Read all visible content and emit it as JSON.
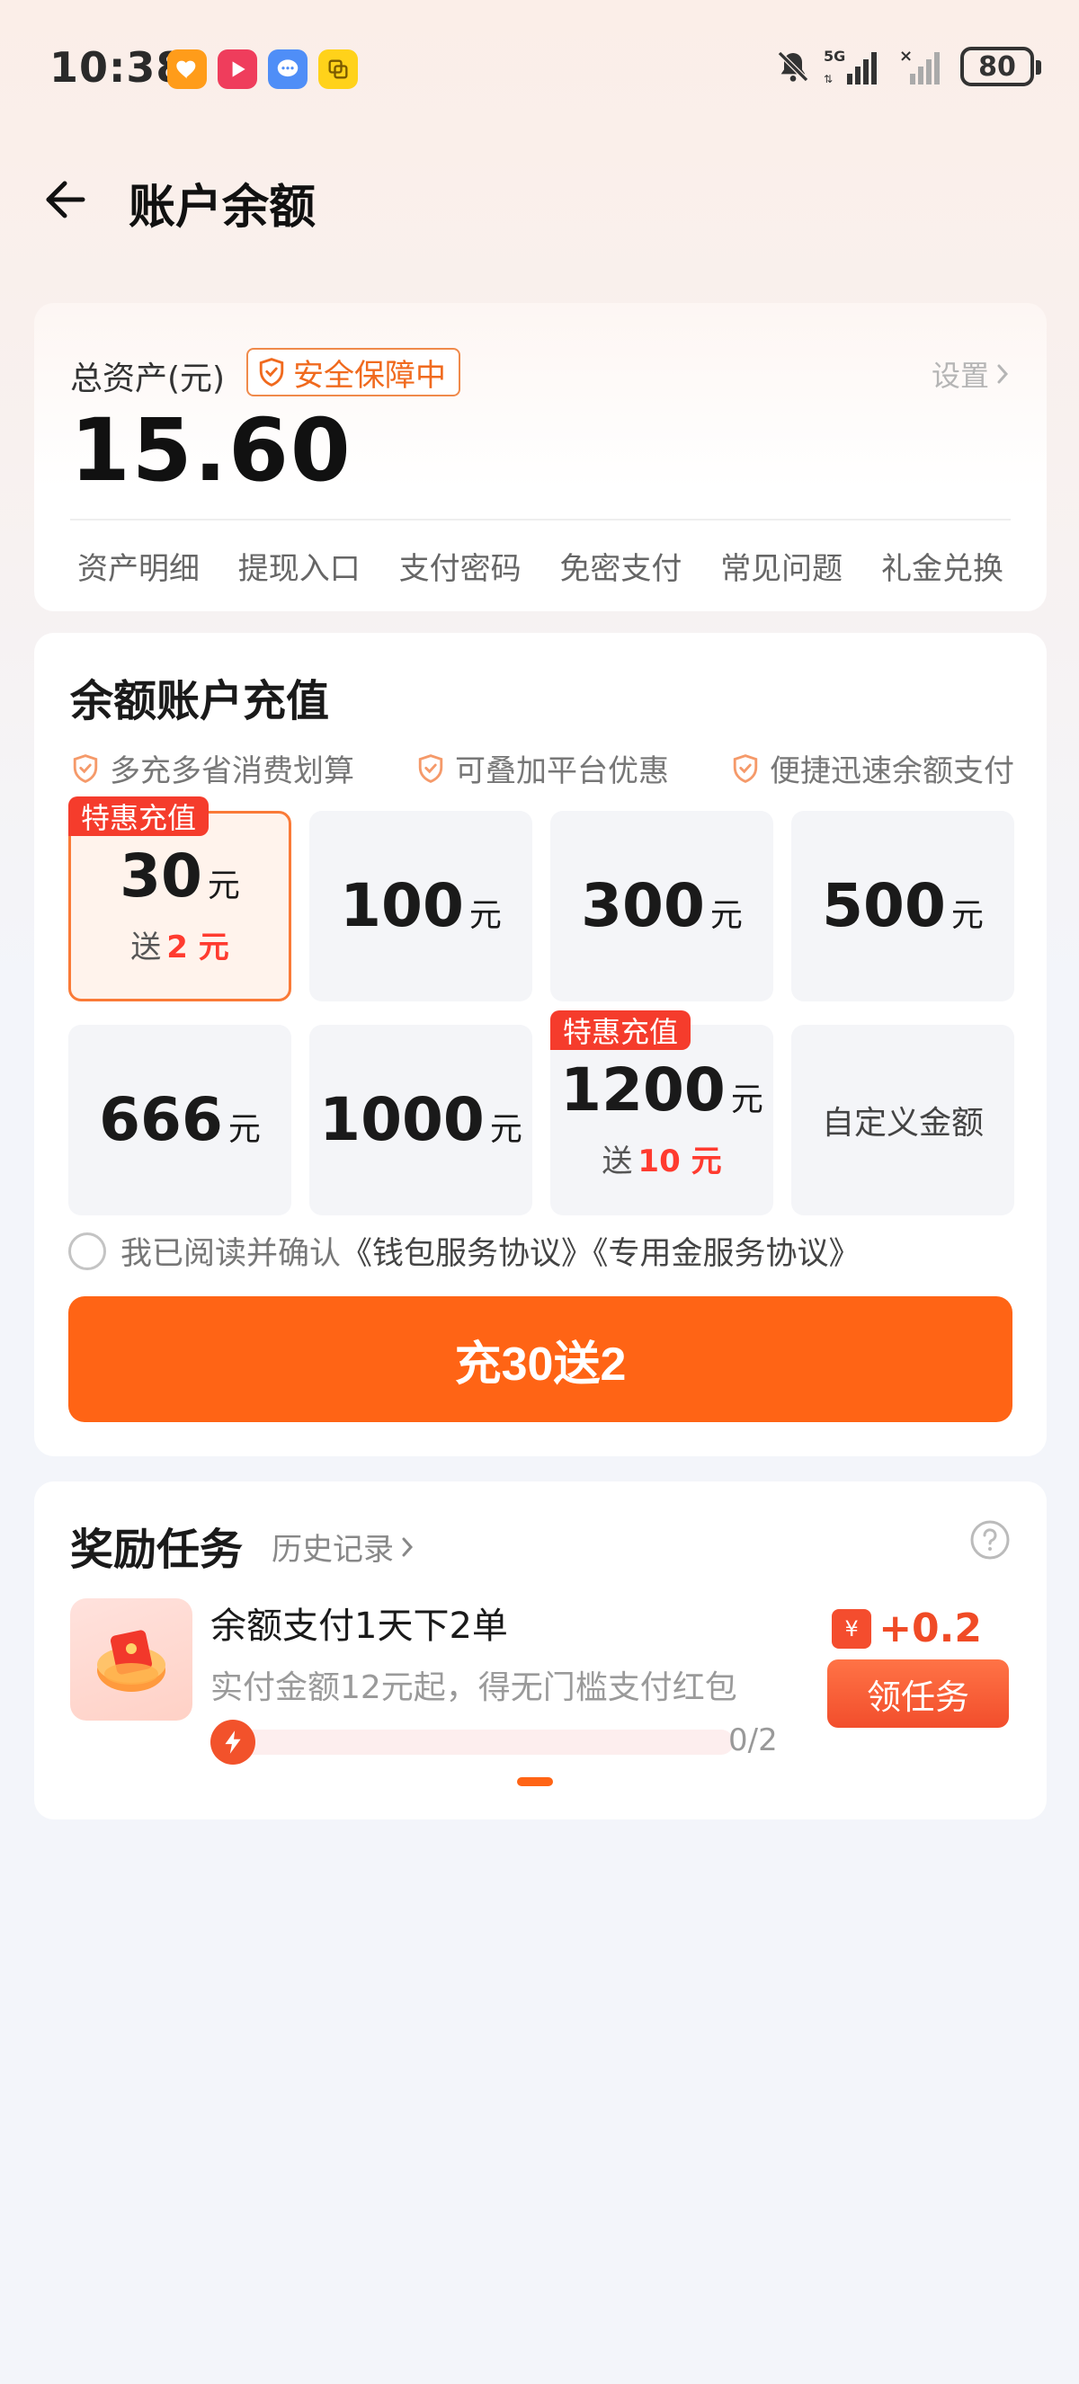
{
  "status_bar": {
    "time": "10:38",
    "battery": "80",
    "network": "5G",
    "app_icons": [
      "heart-app-icon",
      "video-app-icon",
      "message-app-icon",
      "copy-app-icon"
    ],
    "sys_icons": [
      "mute-icon",
      "signal-icon",
      "no-signal-icon",
      "battery-icon"
    ]
  },
  "header": {
    "title": "账户余额",
    "back_icon": "arrow-left-icon"
  },
  "balance": {
    "label": "总资产(元)",
    "safe_badge": "安全保障中",
    "settings": "设置",
    "amount": "15.60",
    "links": [
      "资产明细",
      "提现入口",
      "支付密码",
      "免密支付",
      "常见问题",
      "礼金兑换"
    ]
  },
  "recharge": {
    "title": "余额账户充值",
    "features": [
      "多充多省消费划算",
      "可叠加平台优惠",
      "便捷迅速余额支付"
    ],
    "unit": "元",
    "bonus_prefix": "送",
    "promo_tag": "特惠充值",
    "tiers": [
      {
        "value": "30",
        "bonus": "2 元",
        "selected": true,
        "promo": true
      },
      {
        "value": "100",
        "bonus": null,
        "selected": false,
        "promo": false
      },
      {
        "value": "300",
        "bonus": null,
        "selected": false,
        "promo": false
      },
      {
        "value": "500",
        "bonus": null,
        "selected": false,
        "promo": false
      },
      {
        "value": "666",
        "bonus": null,
        "selected": false,
        "promo": false
      },
      {
        "value": "1000",
        "bonus": null,
        "selected": false,
        "promo": false
      },
      {
        "value": "1200",
        "bonus": "10 元",
        "selected": false,
        "promo": true
      }
    ],
    "custom_tier": "自定义金额",
    "agreement_prefix": "我已阅读并确认",
    "agreement_links": "《钱包服务协议》《专用金服务协议》",
    "cta": "充30送2"
  },
  "tasks": {
    "title": "奖励任务",
    "history": "历史记录",
    "item": {
      "name": "余额支付1天下2单",
      "desc": "实付金额12元起，得无门槛支付红包",
      "progress_text": "0/2",
      "progress_value": 0,
      "reward": "+0.2",
      "reward_icon_text": "¥",
      "button": "领任务"
    }
  },
  "colors": {
    "accent": "#ff6415",
    "promo_red": "#f53c2c",
    "safe_orange": "#f06a1e"
  }
}
